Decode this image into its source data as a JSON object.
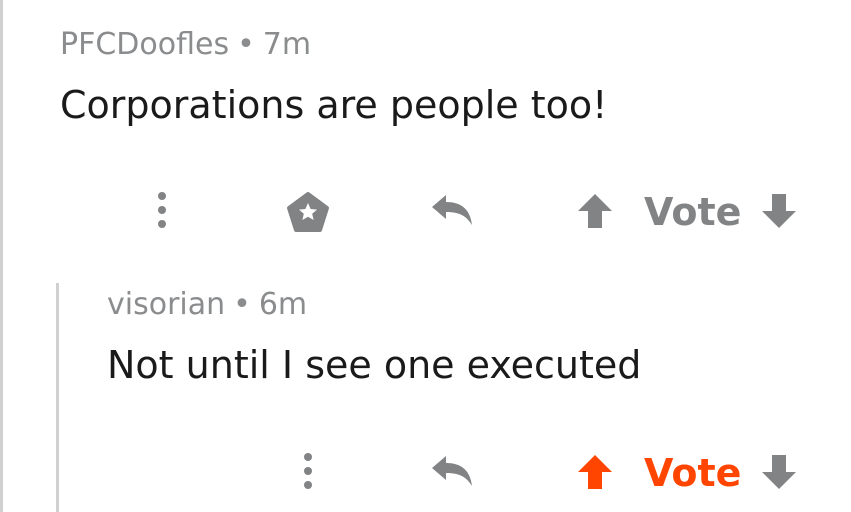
{
  "colors": {
    "meta": "#8a8c8e",
    "text": "#1a1a1b",
    "icon": "#818384",
    "upvote_active": "#ff4500",
    "thread_line": "#d0d0d0"
  },
  "comments": [
    {
      "author": "PFCDoofles",
      "separator": "•",
      "age": "7m",
      "body": "Corporations are people too!",
      "actions": {
        "more_icon": "more-vertical-icon",
        "award_icon": "award-icon",
        "reply_icon": "reply-icon",
        "upvote_icon": "arrow-up-icon",
        "vote_label": "Vote",
        "downvote_icon": "arrow-down-icon",
        "upvoted": false
      }
    },
    {
      "author": "visorian",
      "separator": "•",
      "age": "6m",
      "body": "Not until I see one executed",
      "actions": {
        "more_icon": "more-vertical-icon",
        "reply_icon": "reply-icon",
        "upvote_icon": "arrow-up-icon",
        "vote_label": "Vote",
        "downvote_icon": "arrow-down-icon",
        "upvoted": true
      }
    }
  ]
}
